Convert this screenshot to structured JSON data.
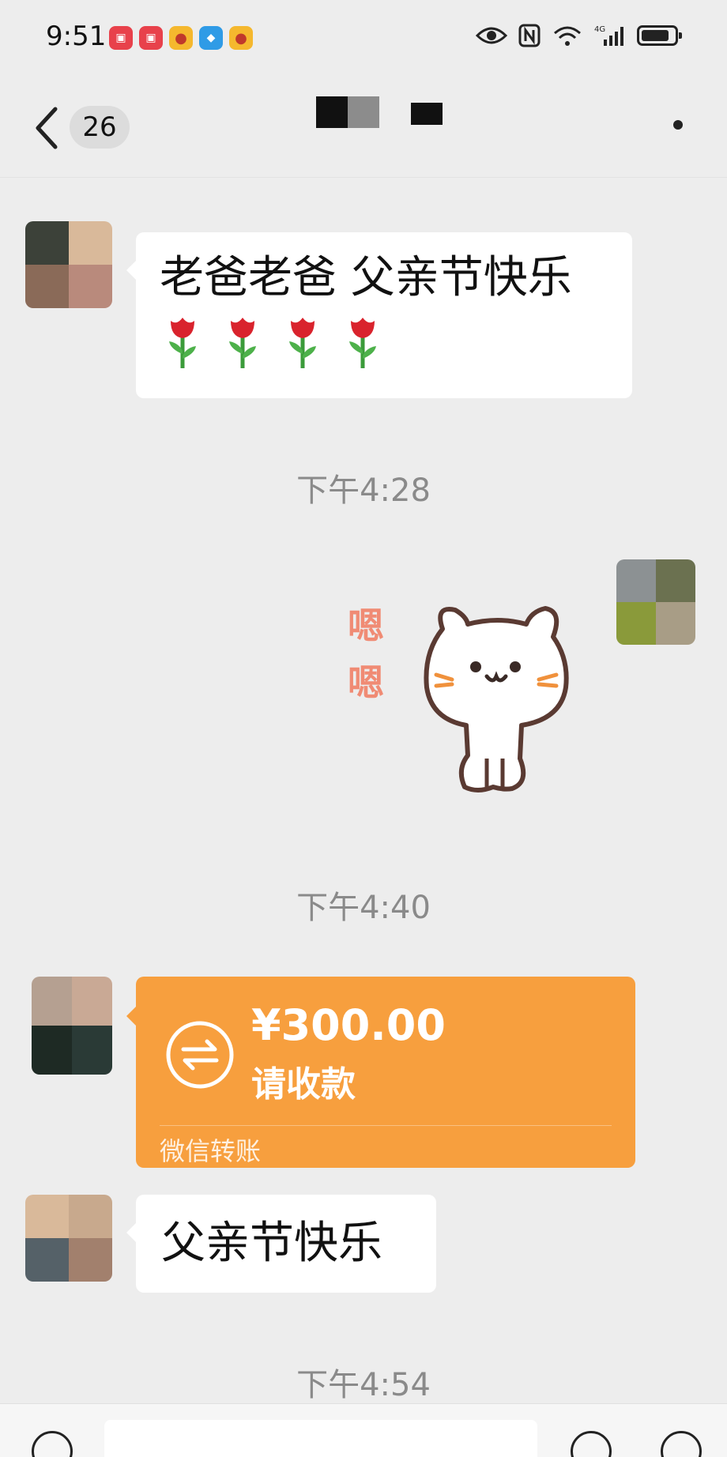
{
  "status_bar": {
    "time": "9:51",
    "network": "4G",
    "app_icons": [
      {
        "name": "red-book-icon",
        "color": "#e8414b",
        "glyph": "📕"
      },
      {
        "name": "red-book-icon",
        "color": "#e8414b",
        "glyph": "📕"
      },
      {
        "name": "weibo-icon",
        "color": "#f5b82e",
        "glyph": "◉"
      },
      {
        "name": "browser-icon",
        "color": "#2f9be6",
        "glyph": "◆"
      },
      {
        "name": "weibo-icon",
        "color": "#f5b82e",
        "glyph": "◉"
      }
    ]
  },
  "nav": {
    "unread_count": "26"
  },
  "messages": [
    {
      "type": "text",
      "side": "left",
      "lines": [
        "老爸老爸 父亲节快乐",
        "🌹🌹🌹🌹"
      ]
    },
    {
      "type": "time",
      "text": "下午4:28"
    },
    {
      "type": "sticker",
      "side": "right",
      "caption": [
        "嗯",
        "嗯"
      ]
    },
    {
      "type": "time",
      "text": "下午4:40"
    },
    {
      "type": "transfer",
      "side": "left",
      "amount": "¥300.00",
      "status": "请收款",
      "label": "微信转账"
    },
    {
      "type": "text",
      "side": "left",
      "lines": [
        "父亲节快乐"
      ]
    },
    {
      "type": "time",
      "text": "下午4:54"
    }
  ],
  "colors": {
    "background": "#ededed",
    "transfer_orange": "#f79f3e",
    "bubble_white": "#ffffff",
    "timestamp_gray": "#8a8a8a"
  }
}
